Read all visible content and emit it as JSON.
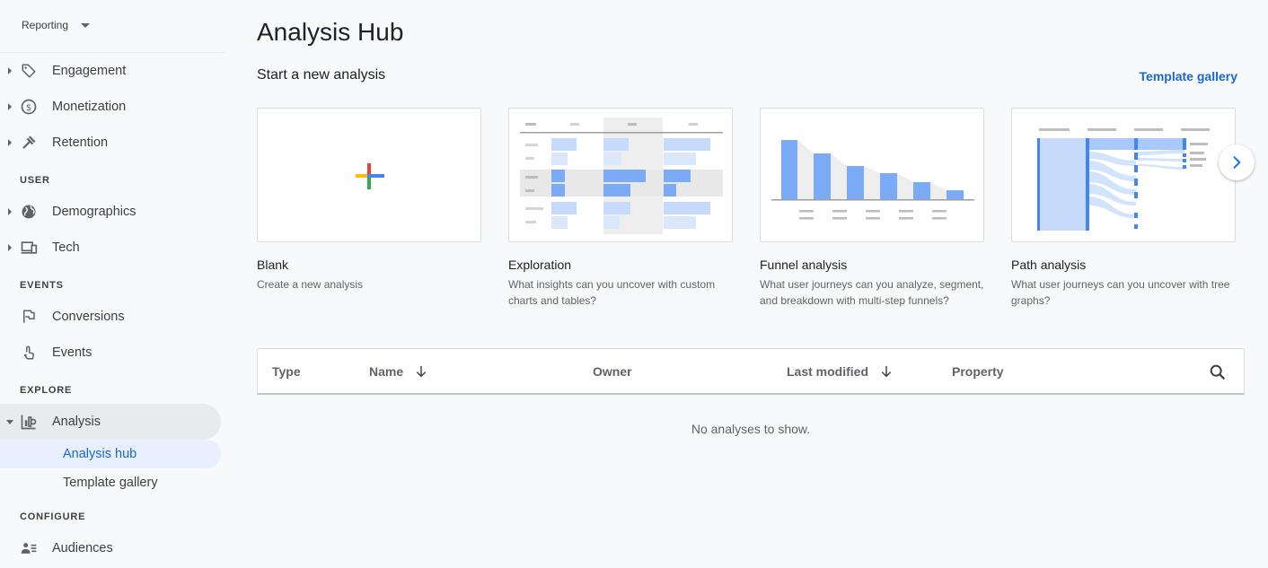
{
  "sidebar": {
    "report_select": "Reporting",
    "items": [
      {
        "label": "Engagement"
      },
      {
        "label": "Monetization"
      },
      {
        "label": "Retention"
      },
      {
        "label": "Demographics"
      },
      {
        "label": "Tech"
      },
      {
        "label": "Conversions"
      },
      {
        "label": "Events"
      },
      {
        "label": "Analysis"
      },
      {
        "label": "Audiences"
      }
    ],
    "sections": {
      "user": "USER",
      "events": "EVENTS",
      "explore": "EXPLORE",
      "configure": "CONFIGURE"
    },
    "sub_items": [
      {
        "label": "Analysis hub"
      },
      {
        "label": "Template gallery"
      }
    ]
  },
  "main": {
    "title": "Analysis Hub",
    "start_label": "Start a new analysis",
    "template_link": "Template gallery",
    "cards": [
      {
        "title": "Blank",
        "desc": "Create a new analysis"
      },
      {
        "title": "Exploration",
        "desc": "What insights can you uncover with custom charts and tables?"
      },
      {
        "title": "Funnel analysis",
        "desc": "What user journeys can you analyze, segment, and breakdown with multi-step funnels?"
      },
      {
        "title": "Path analysis",
        "desc": "What user journeys can you uncover with tree graphs?"
      }
    ]
  },
  "table": {
    "columns": [
      "Type",
      "Name",
      "Owner",
      "Last modified",
      "Property"
    ],
    "empty_text": "No analyses to show."
  },
  "colors": {
    "accent": "#1967d2",
    "chart_blue": "#7baaf7",
    "chart_light": "#c6dafc"
  }
}
